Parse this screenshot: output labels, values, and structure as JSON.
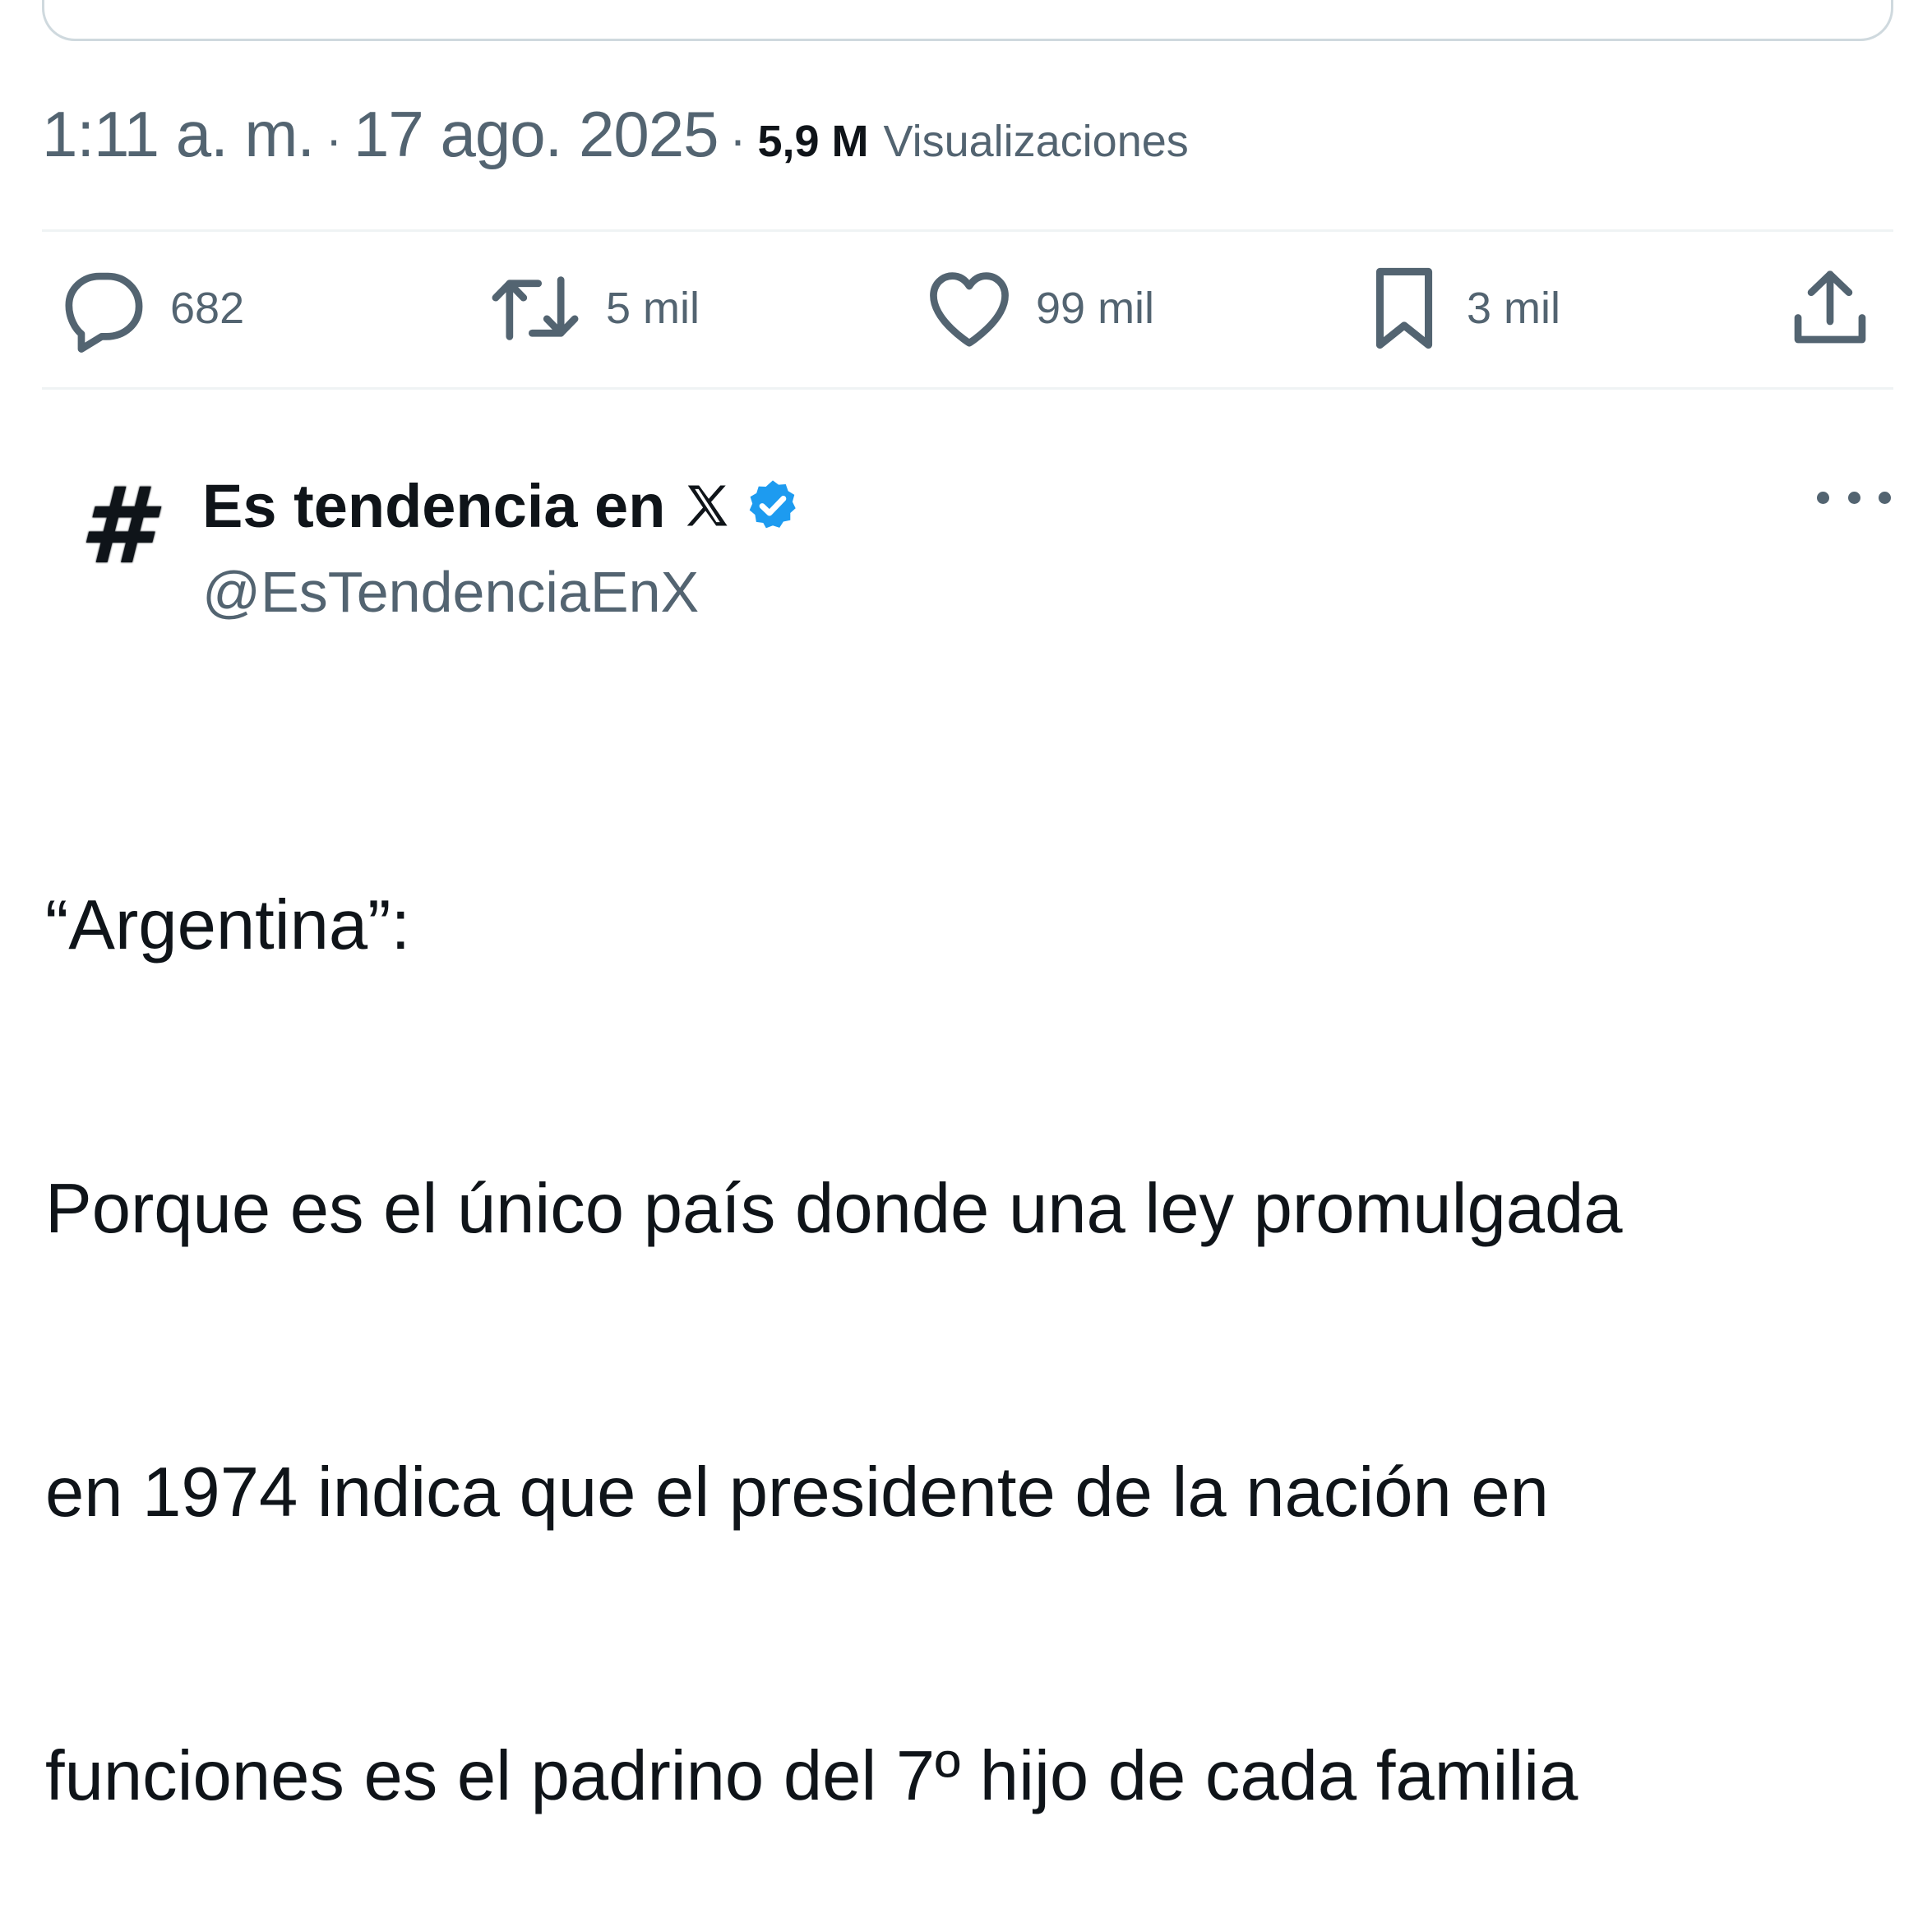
{
  "meta": {
    "time": "1:11 a. m.",
    "separator": "·",
    "date": "17 ago. 2025",
    "views_count": "5,9 M",
    "views_label": "Visualizaciones"
  },
  "actions": {
    "reply_count": "682",
    "retweet_count": "5 mil",
    "like_count": "99 mil",
    "bookmark_count": "3 mil"
  },
  "author": {
    "avatar_glyph": "#",
    "name": "Es tendencia en",
    "brand_glyph": "𝕏",
    "handle": "@EsTendenciaEnX",
    "verified": true
  },
  "tweet": {
    "line1": "“Argentina”:",
    "line2": "Porque es el único país donde una ley promulgada",
    "line3": "en 1974 indica que el presidente de la nación en",
    "line4": "funciones es el padrino del 7º hijo de cada familia"
  },
  "colors": {
    "text_primary": "#0f1419",
    "text_secondary": "#536471",
    "divider": "#eff3f4",
    "verified": "#1d9bf0"
  },
  "icons": [
    "reply-icon",
    "retweet-icon",
    "like-icon",
    "bookmark-icon",
    "share-icon",
    "verified-badge-icon",
    "x-logo-icon",
    "more-icon"
  ]
}
